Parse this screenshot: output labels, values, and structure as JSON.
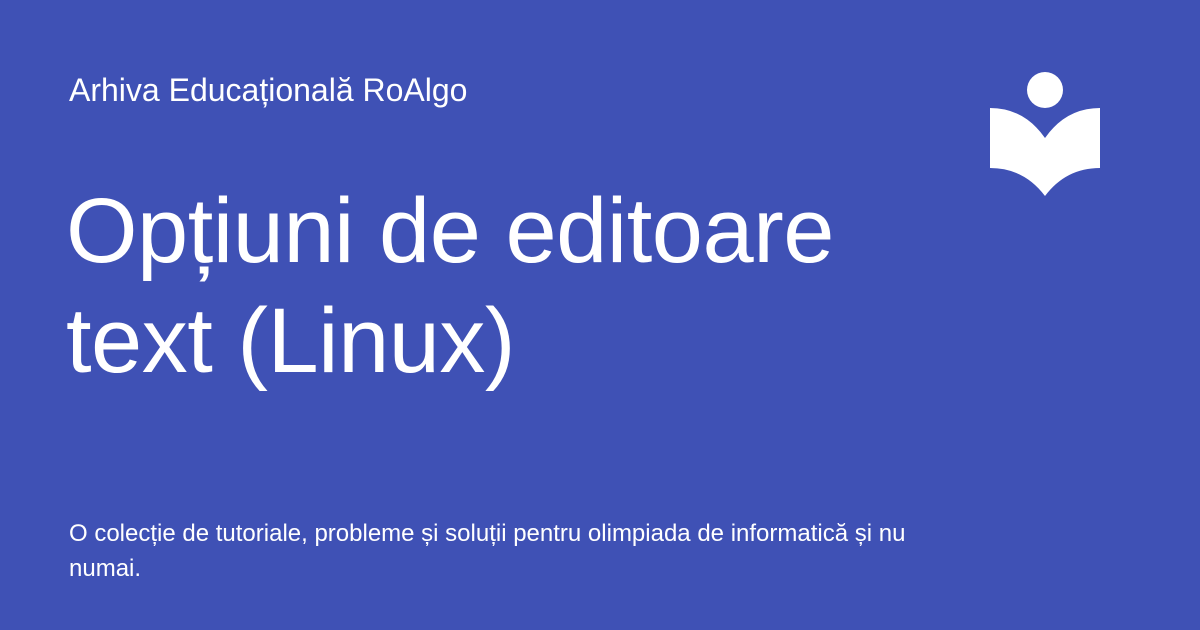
{
  "site": {
    "name": "Arhiva Educațională RoAlgo"
  },
  "article": {
    "title": "Opțiuni de editoare text (Linux)",
    "description": "O colecție de tutoriale, probleme și soluții pentru olimpiada de informatică și nu numai."
  },
  "theme": {
    "background": "#3f51b5",
    "foreground": "#ffffff"
  },
  "logo": {
    "icon": "book-reader-icon"
  }
}
